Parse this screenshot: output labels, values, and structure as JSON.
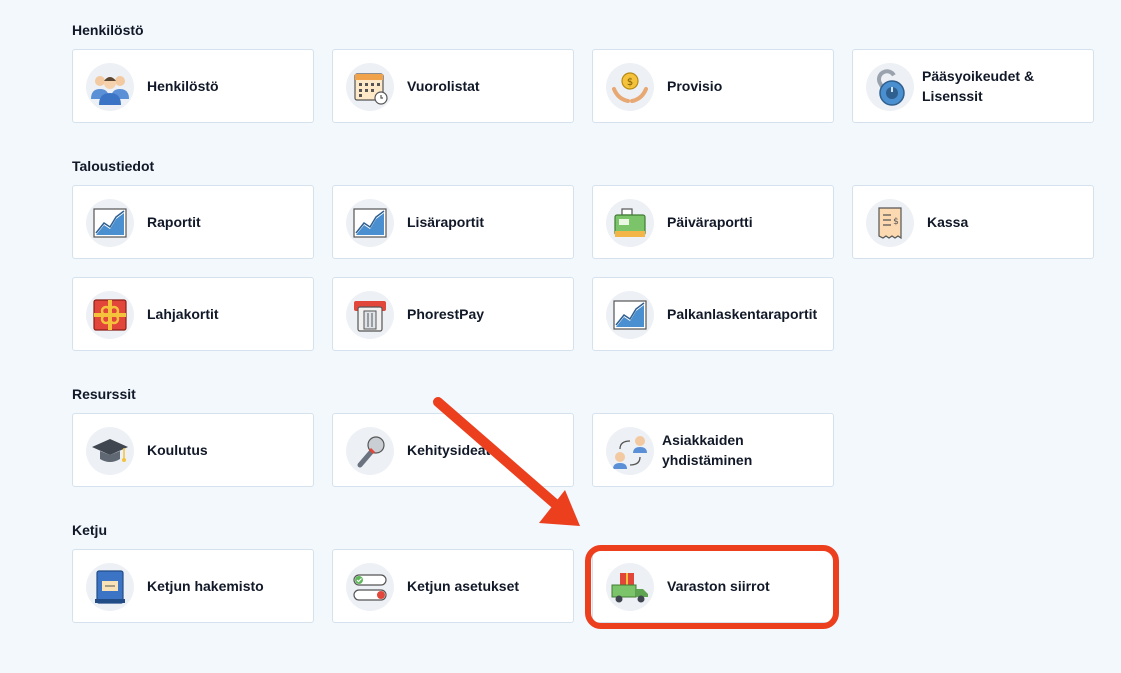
{
  "sections": {
    "henkilosto": "Henkilöstö",
    "taloustiedot": "Taloustiedot",
    "resurssit": "Resurssit",
    "ketju": "Ketju"
  },
  "cards": {
    "henkilosto": "Henkilöstö",
    "vuorolistat": "Vuorolistat",
    "provisio": "Provisio",
    "paasyoikeudet": "Pääsyoikeudet & Lisenssit",
    "raportit": "Raportit",
    "lisaraportit": "Lisäraportit",
    "paivaraportti": "Päiväraportti",
    "kassa": "Kassa",
    "lahjakortit": "Lahjakortit",
    "phorestpay": "PhorestPay",
    "palkanlaskenta": "Palkanlaskentaraportit",
    "koulutus": "Koulutus",
    "kehitysideat": "Kehitysideat",
    "asiakkaiden": "Asiakkaiden yhdistäminen",
    "ketjun_hakemisto": "Ketjun hakemisto",
    "ketjun_asetukset": "Ketjun asetukset",
    "varaston_siirrot": "Varaston siirrot"
  },
  "colors": {
    "background": "#f3f8fd",
    "card_border": "#d5e1ec",
    "annotation": "#ec3f1e"
  }
}
